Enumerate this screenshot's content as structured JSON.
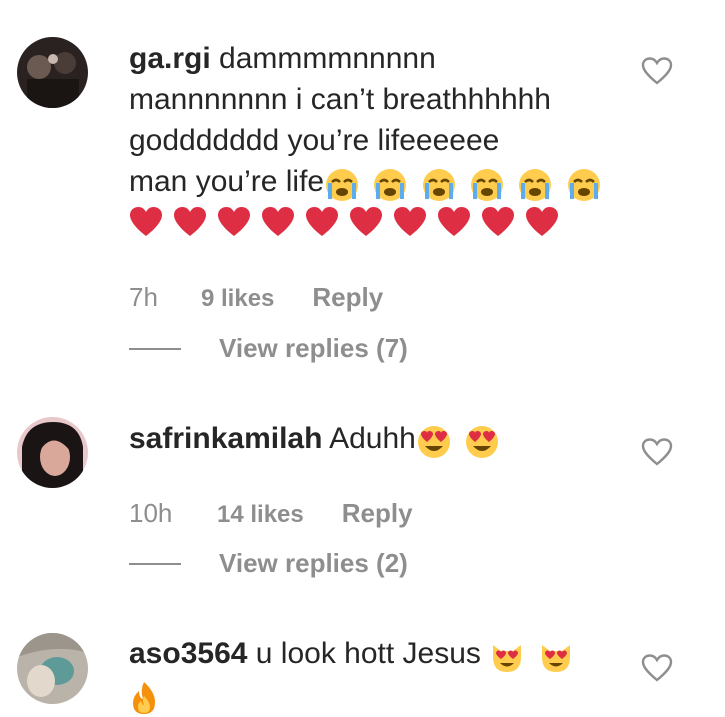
{
  "comments": [
    {
      "username": "ga.rgi",
      "lines": [
        "dammmmnnnnn",
        "mannnnnnn i can’t breathhhhhh",
        "goddddddd you’re lifeeeeee",
        "man you’re life"
      ],
      "emoji_after_last_line": [
        "loudly-crying-face",
        "loudly-crying-face",
        "loudly-crying-face",
        "loudly-crying-face",
        "loudly-crying-face",
        "loudly-crying-face"
      ],
      "hearts": [
        "red-heart",
        "red-heart",
        "red-heart",
        "red-heart",
        "red-heart",
        "red-heart",
        "red-heart",
        "red-heart",
        "red-heart",
        "red-heart"
      ],
      "time": "7h",
      "likes": "9 likes",
      "reply": "Reply",
      "view_replies": "View replies (7)"
    },
    {
      "username": "safrinkamilah",
      "text": "Aduhh",
      "emoji": [
        "heart-eyes-face",
        "heart-eyes-face"
      ],
      "time": "10h",
      "likes": "14 likes",
      "reply": "Reply",
      "view_replies": "View replies (2)"
    },
    {
      "username": "aso3564",
      "text": "u look hott Jesus",
      "emoji": [
        "heart-eyes-cat",
        "heart-eyes-cat",
        "fire"
      ]
    }
  ],
  "colors": {
    "text": "#262626",
    "secondary": "#8e8e8e",
    "heart": "#dd2e44",
    "emoji_yellow": "#ffcc4d",
    "tear_blue": "#5dadec"
  }
}
